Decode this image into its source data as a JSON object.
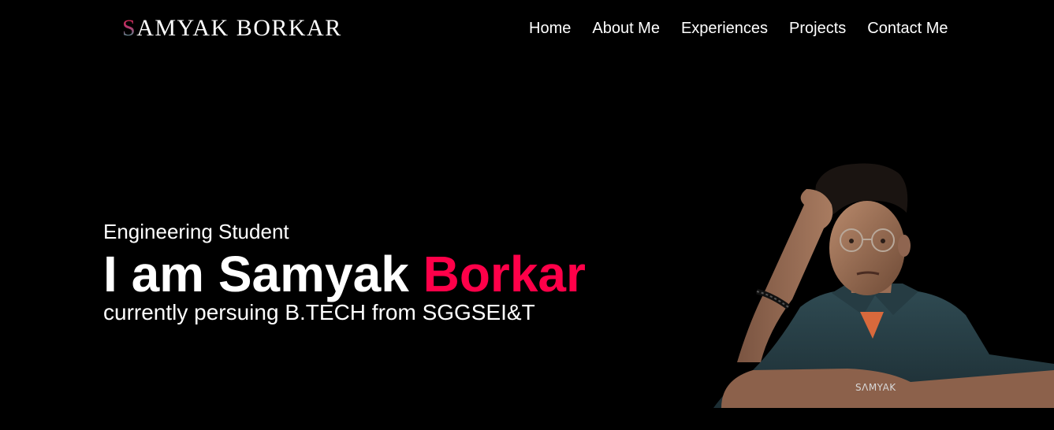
{
  "header": {
    "logo_initial": "S",
    "logo_rest": "AMYAK BORKAR"
  },
  "nav": {
    "items": [
      "Home",
      "About Me",
      "Experiences",
      "Projects",
      "Contact Me"
    ]
  },
  "hero": {
    "subtitle": "Engineering Student",
    "title_prefix": "I am Samyak ",
    "title_accent": "Borkar",
    "description": "currently persuing B.TECH from SGGSEI&T"
  },
  "portrait": {
    "watermark": "SΛMYAK"
  },
  "colors": {
    "background": "#000000",
    "text": "#ffffff",
    "accent": "#ff0049"
  }
}
